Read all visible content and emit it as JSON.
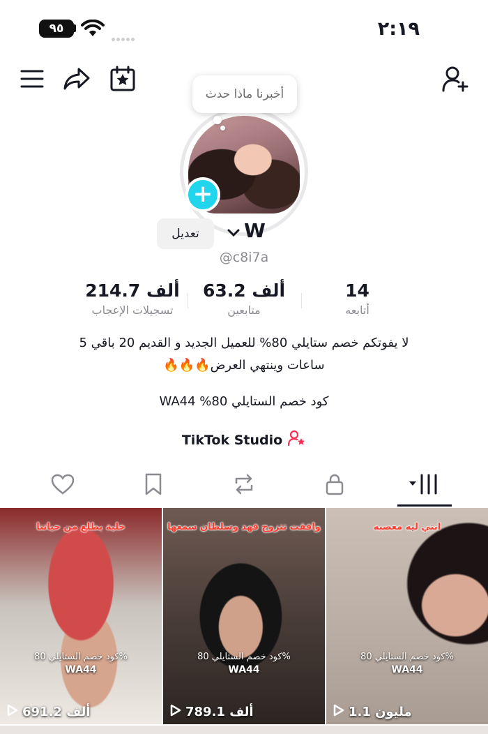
{
  "status_bar": {
    "time": "٢:١٩",
    "battery": "٩٥"
  },
  "bubble": {
    "text": "أخبرنا ماذا حدث"
  },
  "profile": {
    "edit_label": "تعديل",
    "username": "W",
    "handle": "@c8i7a"
  },
  "stats": {
    "likes": {
      "num": "214.7 ألف",
      "label": "تسجيلات الإعجاب"
    },
    "followers": {
      "num": "63.2 ألف",
      "label": "متابعين"
    },
    "following": {
      "num": "14",
      "label": "أتابعه"
    }
  },
  "bio": {
    "line1": "لا يفوتكم خصم ستايلي 80% للعميل الجديد و القديم 20 باقي 5",
    "line2": "ساعات وينتهي العرض🔥🔥🔥",
    "promo": "كود خصم الستايلي 80% WA44",
    "studio": "TikTok Studio"
  },
  "videos": [
    {
      "caption": "خلية بطلع من حياتنا",
      "promo": "كود خصم الستايلي 80%",
      "code": "WA44",
      "views": "691.2 ألف"
    },
    {
      "caption": "وافقت تتزوج فهد وسلطان سمعها",
      "promo": "كود خصم الستايلي 80%",
      "code": "WA44",
      "views": "789.1 ألف"
    },
    {
      "caption": "انتي ليه معصبه",
      "promo": "كود خصم الستايلي 80%",
      "code": "WA44",
      "views": "1.1 مليون"
    }
  ],
  "icons": {
    "menu": "menu-icon",
    "share": "share-icon",
    "calendar": "calendar-star-icon",
    "add_user": "add-user-icon",
    "tabs": [
      "heart-icon",
      "bookmark-icon",
      "repost-icon",
      "lock-icon",
      "grid-icon"
    ]
  },
  "colors": {
    "accent": "#20d5ec",
    "studio": "#fe2c55",
    "caption": "#ff3b2f"
  }
}
